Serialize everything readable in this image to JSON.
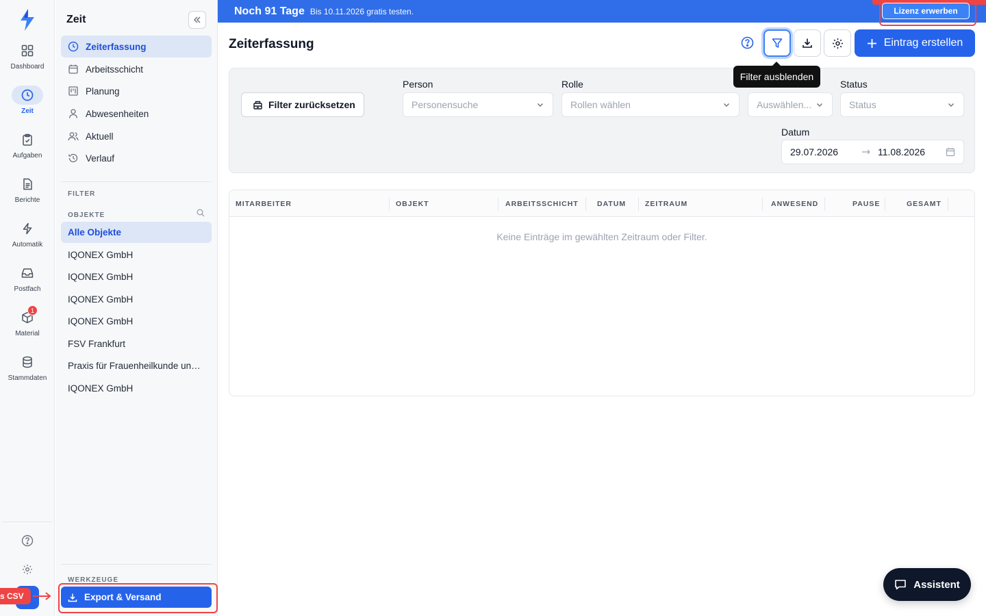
{
  "rail": {
    "items": [
      {
        "label": "Dashboard",
        "icon": "grid-icon"
      },
      {
        "label": "Zeit",
        "icon": "clock-icon",
        "active": true
      },
      {
        "label": "Aufgaben",
        "icon": "clipboard-icon"
      },
      {
        "label": "Berichte",
        "icon": "document-icon"
      },
      {
        "label": "Automatik",
        "icon": "lightning-icon"
      },
      {
        "label": "Postfach",
        "icon": "inbox-icon"
      },
      {
        "label": "Material",
        "icon": "box-icon",
        "badge": "1"
      },
      {
        "label": "Stammdaten",
        "icon": "database-icon"
      }
    ],
    "csv_tag": "s CSV"
  },
  "sidebar": {
    "title": "Zeit",
    "nav": [
      {
        "label": "Zeiterfassung",
        "icon": "clock-icon",
        "active": true
      },
      {
        "label": "Arbeitsschicht",
        "icon": "calendar-icon"
      },
      {
        "label": "Planung",
        "icon": "kanban-icon"
      },
      {
        "label": "Abwesenheiten",
        "icon": "user-icon"
      },
      {
        "label": "Aktuell",
        "icon": "users-icon"
      },
      {
        "label": "Verlauf",
        "icon": "history-icon"
      }
    ],
    "filter_caption": "FILTER",
    "objects_caption": "OBJEKTE",
    "objects": [
      {
        "label": "Alle Objekte",
        "active": true
      },
      {
        "label": "IQONEX GmbH"
      },
      {
        "label": "IQONEX GmbH"
      },
      {
        "label": "IQONEX GmbH"
      },
      {
        "label": "IQONEX GmbH"
      },
      {
        "label": "FSV Frankfurt"
      },
      {
        "label": "Praxis für Frauenheilkunde und Geburtshilfe"
      },
      {
        "label": "IQONEX GmbH"
      }
    ],
    "tools_caption": "WERKZEUGE",
    "export_label": "Export & Versand"
  },
  "banner": {
    "title": "Noch 91 Tage",
    "subtitle": "Bis 10.11.2026 gratis testen.",
    "license_button": "Lizenz erwerben"
  },
  "header": {
    "title": "Zeiterfassung",
    "tooltip": "Filter ausblenden",
    "create_button": "Eintrag erstellen"
  },
  "filters": {
    "reset_button": "Filter zurücksetzen",
    "person_label": "Person",
    "person_placeholder": "Personensuche",
    "role_label": "Rolle",
    "role_placeholder": "Rollen wählen",
    "extra_placeholder": "Auswählen...",
    "status_label": "Status",
    "status_placeholder": "Status",
    "date_label": "Datum",
    "date_from": "29.07.2026",
    "date_to": "11.08.2026"
  },
  "table": {
    "columns": [
      "MITARBEITER",
      "OBJEKT",
      "ARBEITSSCHICHT",
      "DATUM",
      "ZEITRAUM",
      "ANWESEND",
      "PAUSE",
      "GESAMT"
    ],
    "empty_message": "Keine Einträge im gewählten Zeitraum oder Filter."
  },
  "assistant": {
    "label": "Assistent"
  },
  "colors": {
    "accent": "#2563eb",
    "banner": "#2f6ee8",
    "highlight": "#ef4444"
  }
}
